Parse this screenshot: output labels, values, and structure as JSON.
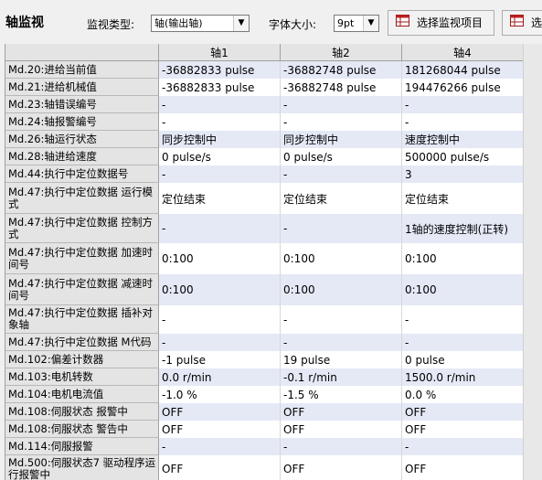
{
  "title": "轴监视",
  "monitor_type_label": "监视类型:",
  "monitor_type_value": "轴(输出轴)",
  "font_size_label": "字体大小:",
  "font_size_value": "9pt",
  "select_items_button": "选择监视项目",
  "cut_button": "选",
  "columns": [
    "轴1",
    "轴2",
    "轴4"
  ],
  "rows": [
    {
      "label": "Md.20:进给当前值",
      "values": [
        "-36882833 pulse",
        "-36882748 pulse",
        "181268044 pulse"
      ]
    },
    {
      "label": "Md.21:进给机械值",
      "values": [
        "-36882833 pulse",
        "-36882748 pulse",
        "194476266 pulse"
      ]
    },
    {
      "label": "Md.23:轴错误编号",
      "values": [
        "-",
        "-",
        "-"
      ]
    },
    {
      "label": "Md.24:轴报警编号",
      "values": [
        "-",
        "-",
        "-"
      ]
    },
    {
      "label": "Md.26:轴运行状态",
      "values": [
        "同步控制中",
        "同步控制中",
        "速度控制中"
      ]
    },
    {
      "label": "Md.28:轴进给速度",
      "values": [
        "0 pulse/s",
        "0 pulse/s",
        "500000 pulse/s"
      ]
    },
    {
      "label": "Md.44:执行中定位数据号",
      "values": [
        "-",
        "-",
        "3"
      ]
    },
    {
      "label": "Md.47:执行中定位数据 运行模式",
      "values": [
        "定位结束",
        "定位结束",
        "定位结束"
      ]
    },
    {
      "label": "Md.47:执行中定位数据 控制方式",
      "values": [
        "-",
        "-",
        "1轴的速度控制(正转)"
      ]
    },
    {
      "label": "Md.47:执行中定位数据 加速时间号",
      "values": [
        "0:100",
        "0:100",
        "0:100"
      ]
    },
    {
      "label": "Md.47:执行中定位数据 减速时间号",
      "values": [
        "0:100",
        "0:100",
        "0:100"
      ]
    },
    {
      "label": "Md.47:执行中定位数据 插补对象轴",
      "values": [
        "-",
        "-",
        "-"
      ]
    },
    {
      "label": "Md.47:执行中定位数据 M代码",
      "values": [
        "-",
        "-",
        "-"
      ]
    },
    {
      "label": "Md.102:偏差计数器",
      "values": [
        "-1 pulse",
        "19 pulse",
        "0 pulse"
      ]
    },
    {
      "label": "Md.103:电机转数",
      "values": [
        "0.0 r/min",
        "-0.1 r/min",
        "1500.0 r/min"
      ]
    },
    {
      "label": "Md.104:电机电流值",
      "values": [
        "-1.0 %",
        "-1.5 %",
        "0.0 %"
      ]
    },
    {
      "label": "Md.108:伺服状态 报警中",
      "values": [
        "OFF",
        "OFF",
        "OFF"
      ]
    },
    {
      "label": "Md.108:伺服状态 警告中",
      "values": [
        "OFF",
        "OFF",
        "OFF"
      ]
    },
    {
      "label": "Md.114:伺服报警",
      "values": [
        "-",
        "-",
        "-"
      ]
    },
    {
      "label": "Md.500:伺服状态7 驱动程序运行报警中",
      "values": [
        "OFF",
        "OFF",
        "OFF"
      ]
    }
  ],
  "colors": {
    "highlight_row": "#e5e9f6",
    "header_bg": "#e4e4e4",
    "grid_line": "#a0a0a0"
  }
}
